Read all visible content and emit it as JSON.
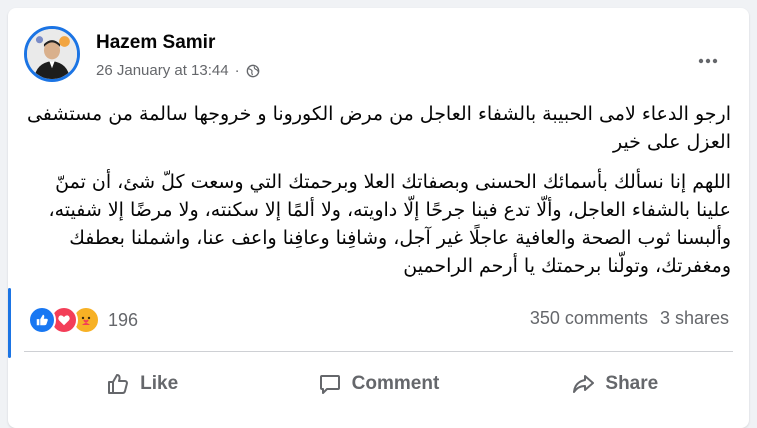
{
  "post": {
    "author": "Hazem Samir",
    "timestamp": "26 January at 13:44",
    "separator": "·",
    "privacy_icon": "globe-icon",
    "paragraphs": [
      "ارجو الدعاء لامى الحبيبة بالشفاء العاجل من مرض الكورونا و خروجها سالمة من مستشفى العزل على خير",
      "اللهم إنا نسألك بأسمائك الحسنى وبصفاتك العلا وبرحمتك التي وسعت كلّ شئ، أن تمنّ علينا بالشفاء العاجل، وألّا تدع فينا جرحًا إلّا داويته، ولا ألمًا إلا سكنته، ولا مرضًا إلا شفيته، وألبسنا ثوب الصحة والعافية عاجلًا غير آجل، وشافِنا وعافِنا واعف عنا، واشملنا بعطفك ومغفرتك، وتولّنا برحمتك يا أرحم الراحمين"
    ]
  },
  "stats": {
    "reaction_count": "196",
    "reactions": [
      "like",
      "love",
      "care"
    ],
    "comments": "350 comments",
    "shares": "3 shares"
  },
  "actions": {
    "like": "Like",
    "comment": "Comment",
    "share": "Share"
  },
  "colors": {
    "accent": "#1b74e4",
    "like": "#1877f2",
    "love": "#f33e58",
    "care": "#f7b125",
    "secondary_text": "#65676b"
  }
}
